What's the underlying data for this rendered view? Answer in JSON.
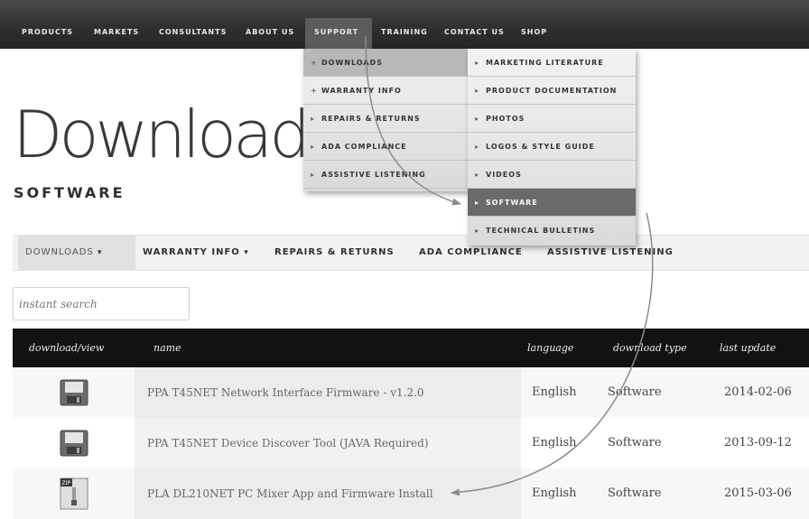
{
  "topnav": {
    "items": [
      "PRODUCTS",
      "MARKETS",
      "CONSULTANTS",
      "ABOUT US",
      "SUPPORT",
      "TRAINING",
      "CONTACT US",
      "SHOP"
    ],
    "active": "SUPPORT"
  },
  "support_menu": {
    "items": [
      {
        "label": "DOWNLOADS",
        "glyph": "+"
      },
      {
        "label": "WARRANTY INFO",
        "glyph": "+"
      },
      {
        "label": "REPAIRS & RETURNS",
        "glyph": "▸"
      },
      {
        "label": "ADA COMPLIANCE",
        "glyph": "▸"
      },
      {
        "label": "ASSISTIVE LISTENING",
        "glyph": "▸"
      }
    ]
  },
  "downloads_menu": {
    "items": [
      {
        "label": "MARKETING LITERATURE"
      },
      {
        "label": "PRODUCT DOCUMENTATION"
      },
      {
        "label": "PHOTOS"
      },
      {
        "label": "LOGOS & STYLE GUIDE"
      },
      {
        "label": "VIDEOS"
      },
      {
        "label": "SOFTWARE"
      },
      {
        "label": "TECHNICAL BULLETINS"
      }
    ],
    "glyph": "▸",
    "selected": "SOFTWARE"
  },
  "page": {
    "title": "Downloads",
    "subtitle": "SOFTWARE"
  },
  "tabs": [
    {
      "label": "DOWNLOADS",
      "caret": "▾"
    },
    {
      "label": "WARRANTY INFO",
      "caret": "▾"
    },
    {
      "label": "REPAIRS & RETURNS",
      "caret": ""
    },
    {
      "label": "ADA COMPLIANCE",
      "caret": ""
    },
    {
      "label": "ASSISTIVE LISTENING",
      "caret": ""
    }
  ],
  "search": {
    "placeholder": "instant search"
  },
  "table": {
    "headers": {
      "download": "download/view",
      "name": "name",
      "language": "language",
      "type": "download type",
      "updated": "last update"
    },
    "rows": [
      {
        "icon": "floppy-disk-icon",
        "name": "PPA T45NET Network Interface Firmware - v1.2.0",
        "language": "English",
        "type": "Software",
        "updated": "2014-02-06"
      },
      {
        "icon": "floppy-disk-icon",
        "name": "PPA T45NET Device Discover Tool (JAVA Required)",
        "language": "English",
        "type": "Software",
        "updated": "2013-09-12"
      },
      {
        "icon": "zip-file-icon",
        "name": "PLA DL210NET PC Mixer App and Firmware Install",
        "language": "English",
        "type": "Software",
        "updated": "2015-03-06",
        "zip_label": "ZIP"
      }
    ]
  },
  "colors": {
    "nav_bg": "#2e2e2e",
    "header_bg": "#121212",
    "selected_item": "#6a6a6a"
  }
}
